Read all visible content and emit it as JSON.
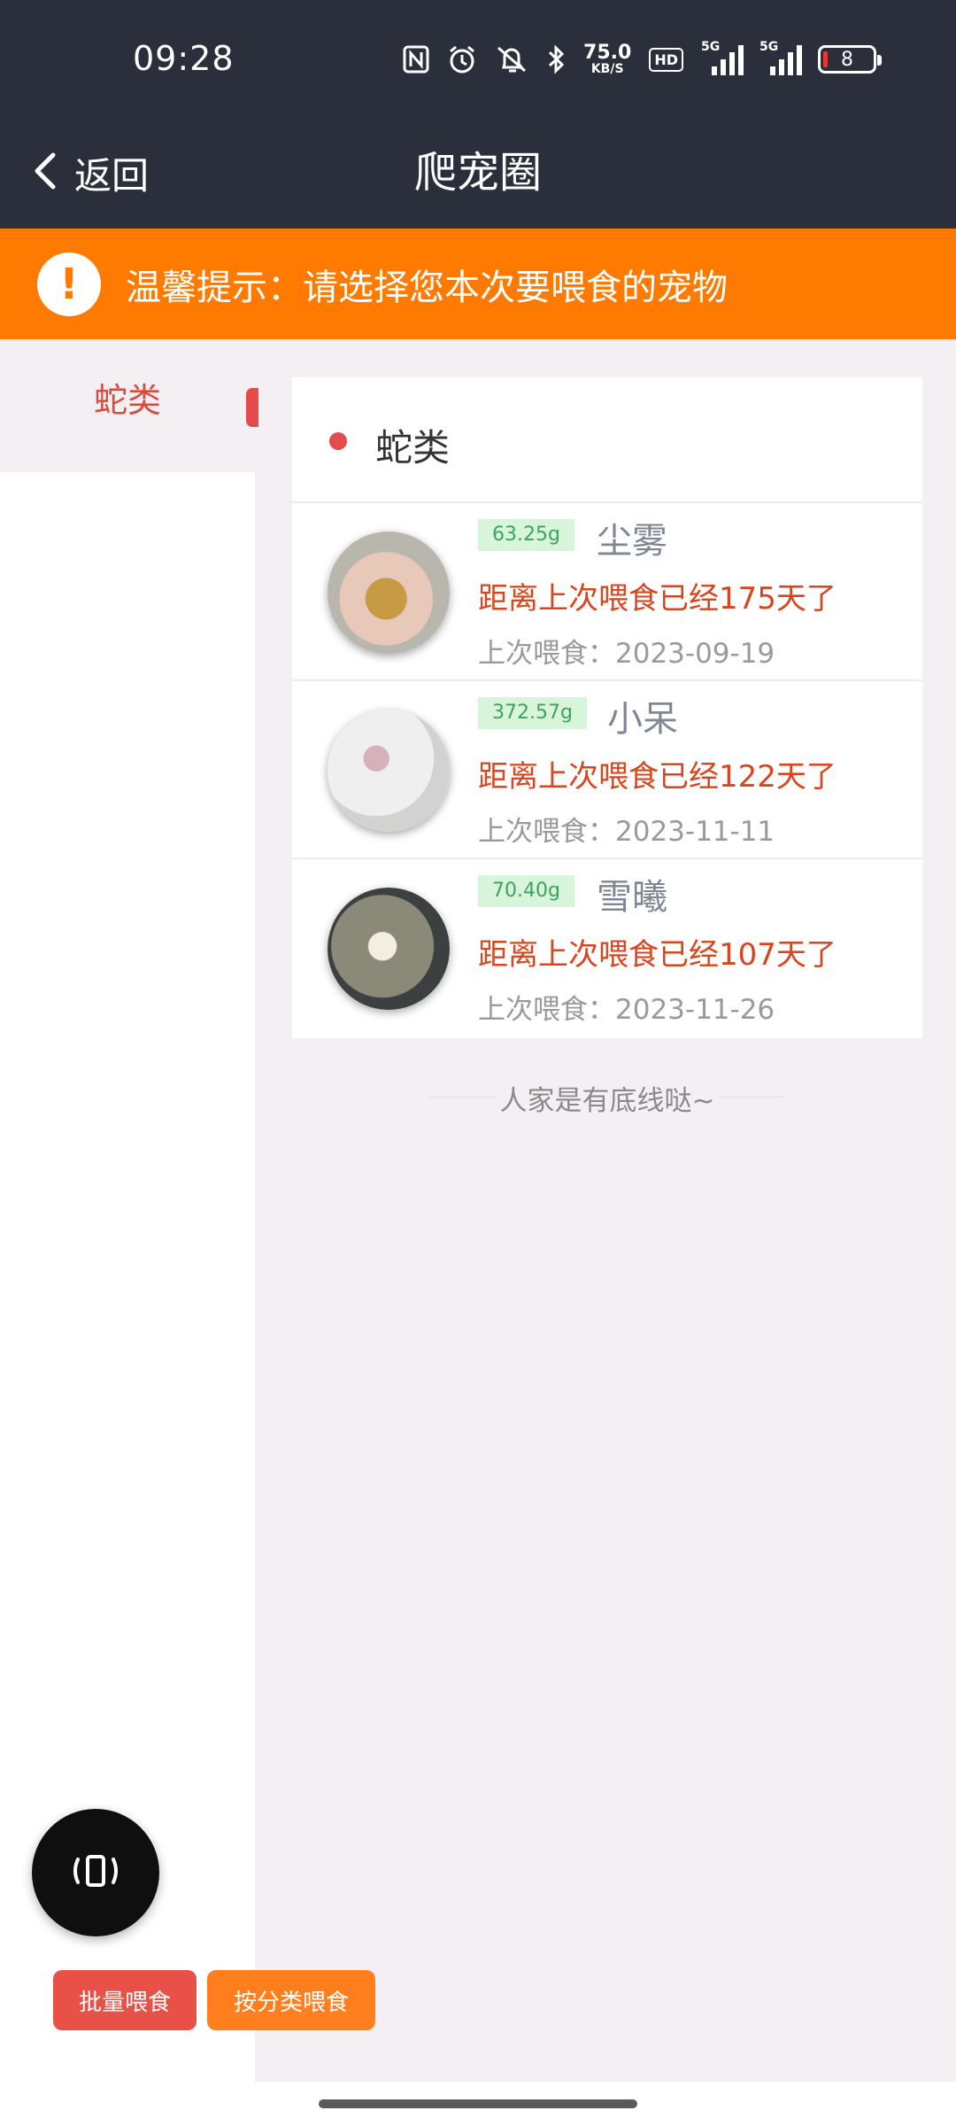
{
  "status_bar": {
    "time": "09:28",
    "network_speed_value": "75.0",
    "network_speed_unit": "KB/S",
    "hd_label": "HD",
    "signal1_label": "5G",
    "signal2_label": "5G",
    "battery_level": "8",
    "icons": [
      "nfc-icon",
      "alarm-icon",
      "mute-icon",
      "bluetooth-icon",
      "hd-icon",
      "signal-icon",
      "signal-icon",
      "battery-icon"
    ]
  },
  "nav": {
    "back_label": "返回",
    "title": "爬宠圈"
  },
  "tip": {
    "icon": "exclamation-icon",
    "text": "温馨提示：请选择您本次要喂食的宠物"
  },
  "sidebar": {
    "items": [
      {
        "label": "蛇类",
        "active": true
      }
    ]
  },
  "category_card": {
    "title": "蛇类",
    "pets": [
      {
        "weight": "63.25g",
        "name": "尘雾",
        "days_text": "距离上次喂食已经175天了",
        "last_feed": "上次喂食：2023-09-19"
      },
      {
        "weight": "372.57g",
        "name": "小呆",
        "days_text": "距离上次喂食已经122天了",
        "last_feed": "上次喂食：2023-11-11"
      },
      {
        "weight": "70.40g",
        "name": "雪曦",
        "days_text": "距离上次喂食已经107天了",
        "last_feed": "上次喂食：2023-11-26"
      }
    ]
  },
  "end_text": "人家是有底线哒~",
  "actions": {
    "batch_feed": "批量喂食",
    "category_feed": "按分类喂食"
  },
  "colors": {
    "header_bg": "#2b2f3c",
    "tip_bg": "#ff7a00",
    "accent_red": "#e54b4b",
    "days_red": "#d9461e",
    "weight_green": "#3ba55d"
  }
}
